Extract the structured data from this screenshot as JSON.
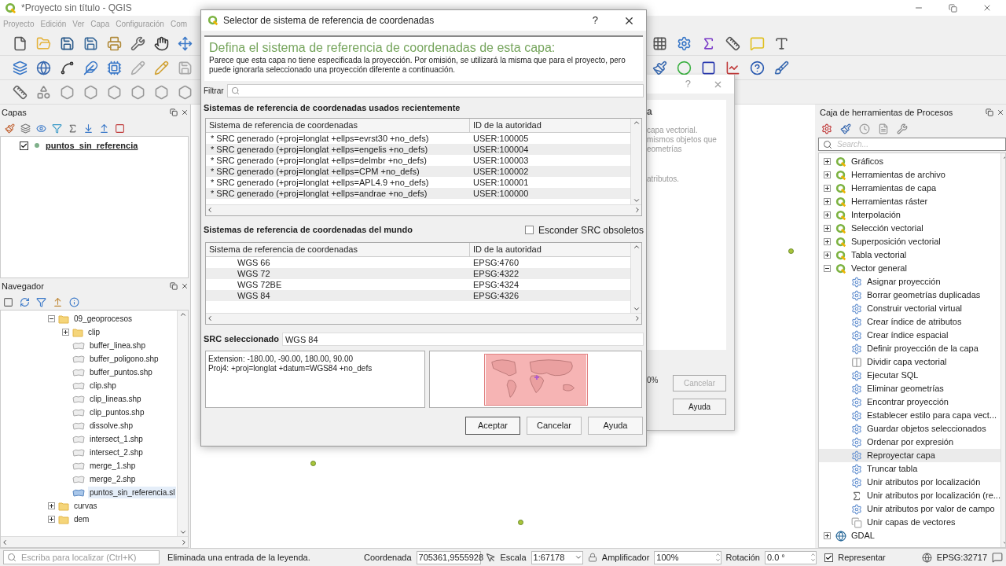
{
  "window": {
    "title": "*Proyecto sin título - QGIS"
  },
  "menu": [
    "Proyecto",
    "Edición",
    "Ver",
    "Capa",
    "Configuración",
    "Com"
  ],
  "layers_panel": {
    "title": "Capas",
    "layers": [
      {
        "name": "puntos_sin_referencia",
        "checked": true
      }
    ]
  },
  "browser_panel": {
    "title": "Navegador",
    "tree": [
      {
        "label": "09_geoprocesos",
        "kind": "folder",
        "expanded": true,
        "selected": false,
        "children": [
          {
            "label": "clip",
            "kind": "folder",
            "expanded": false,
            "selected": false
          },
          {
            "label": "buffer_linea.shp",
            "kind": "file",
            "selected": false
          },
          {
            "label": "buffer_poligono.shp",
            "kind": "file",
            "selected": false
          },
          {
            "label": "buffer_puntos.shp",
            "kind": "file",
            "selected": false
          },
          {
            "label": "clip.shp",
            "kind": "file",
            "selected": false
          },
          {
            "label": "clip_lineas.shp",
            "kind": "file",
            "selected": false
          },
          {
            "label": "clip_puntos.shp",
            "kind": "file",
            "selected": false
          },
          {
            "label": "dissolve.shp",
            "kind": "file",
            "selected": false
          },
          {
            "label": "intersect_1.shp",
            "kind": "file",
            "selected": false
          },
          {
            "label": "intersect_2.shp",
            "kind": "file",
            "selected": false
          },
          {
            "label": "merge_1.shp",
            "kind": "file",
            "selected": false
          },
          {
            "label": "merge_2.shp",
            "kind": "file",
            "selected": false
          },
          {
            "label": "puntos_sin_referencia.sl",
            "kind": "file",
            "selected": true
          }
        ]
      },
      {
        "label": "curvas",
        "kind": "folder",
        "expanded": false,
        "selected": false
      },
      {
        "label": "dem",
        "kind": "folder",
        "expanded": false,
        "selected": false
      }
    ]
  },
  "background_dialog": {
    "help_mark": "?",
    "heading_fragment": "a",
    "text_lines": [
      "capa vectorial.",
      "mismos objetos que",
      "eometrías"
    ],
    "text_tail": "atributos.",
    "progress_fragment": "0%",
    "buttons": [
      {
        "label": "Cancelar",
        "disabled": true
      },
      {
        "label": "Ayuda",
        "disabled": false
      }
    ]
  },
  "crs_dialog": {
    "title": "Selector de sistema de referencia de coordenadas",
    "help_mark": "?",
    "heading": "Defina el sistema de referencia de coordenadas de esta capa:",
    "description": "Parece que esta capa no tiene especificada la proyección. Por omisión, se utilizará la misma que para el proyecto, pero puede ignorarla seleccionado una proyección diferente a continuación.",
    "filter_label": "Filtrar",
    "recent": {
      "title": "Sistemas de referencia de coordenadas usados recientemente",
      "columns": [
        "Sistema de referencia de coordenadas",
        "ID de la autoridad"
      ],
      "rows": [
        {
          "name": "* SRC generado (+proj=longlat +ellps=evrst30 +no_defs)",
          "id": "USER:100005"
        },
        {
          "name": "* SRC generado (+proj=longlat +ellps=engelis +no_defs)",
          "id": "USER:100004"
        },
        {
          "name": "* SRC generado (+proj=longlat +ellps=delmbr +no_defs)",
          "id": "USER:100003"
        },
        {
          "name": "* SRC generado (+proj=longlat +ellps=CPM +no_defs)",
          "id": "USER:100002"
        },
        {
          "name": "* SRC generado (+proj=longlat +ellps=APL4.9 +no_defs)",
          "id": "USER:100001"
        },
        {
          "name": "* SRC generado (+proj=longlat +ellps=andrae +no_defs)",
          "id": "USER:100000"
        }
      ]
    },
    "world": {
      "title": "Sistemas de referencia de coordenadas del mundo",
      "hide_obsolete": {
        "label": "Esconder SRC obsoletos",
        "checked": false
      },
      "columns": [
        "Sistema de referencia de coordenadas",
        "ID de la autoridad"
      ],
      "rows": [
        {
          "name": "WGS 66",
          "id": "EPSG:4760"
        },
        {
          "name": "WGS 72",
          "id": "EPSG:4322"
        },
        {
          "name": "WGS 72BE",
          "id": "EPSG:4324"
        },
        {
          "name": "WGS 84",
          "id": "EPSG:4326"
        }
      ]
    },
    "selected_crs": {
      "label": "SRC seleccionado",
      "value": "WGS 84"
    },
    "details": [
      "Extension: -180.00, -90.00, 180.00, 90.00",
      "Proj4: +proj=longlat +datum=WGS84 +no_defs"
    ],
    "buttons": [
      "Aceptar",
      "Cancelar",
      "Ayuda"
    ]
  },
  "toolbox": {
    "title": "Caja de herramientas de Procesos",
    "search_placeholder": "Search...",
    "groups": [
      {
        "label": "Gráficos",
        "kind": "qgis",
        "expanded": false
      },
      {
        "label": "Herramientas de archivo",
        "kind": "qgis",
        "expanded": false
      },
      {
        "label": "Herramientas de capa",
        "kind": "qgis",
        "expanded": false
      },
      {
        "label": "Herramientas ráster",
        "kind": "qgis",
        "expanded": false
      },
      {
        "label": "Interpolación",
        "kind": "qgis",
        "expanded": false
      },
      {
        "label": "Selección vectorial",
        "kind": "qgis",
        "expanded": false
      },
      {
        "label": "Superposición vectorial",
        "kind": "qgis",
        "expanded": false
      },
      {
        "label": "Tabla vectorial",
        "kind": "qgis",
        "expanded": false
      },
      {
        "label": "Vector general",
        "kind": "qgis",
        "expanded": true,
        "children": [
          {
            "label": "Asignar proyección",
            "kind": "gear",
            "selected": false
          },
          {
            "label": "Borrar geometrías duplicadas",
            "kind": "gear",
            "selected": false
          },
          {
            "label": "Construir vectorial virtual",
            "kind": "gear",
            "selected": false
          },
          {
            "label": "Crear índice de atributos",
            "kind": "gear",
            "selected": false
          },
          {
            "label": "Crear índice espacial",
            "kind": "gear",
            "selected": false
          },
          {
            "label": "Definir proyección de la capa",
            "kind": "gear",
            "selected": false
          },
          {
            "label": "Dividir capa vectorial",
            "kind": "split",
            "selected": false
          },
          {
            "label": "Ejecutar SQL",
            "kind": "gear",
            "selected": false
          },
          {
            "label": "Eliminar geometrías",
            "kind": "gear",
            "selected": false
          },
          {
            "label": "Encontrar proyección",
            "kind": "gear",
            "selected": false
          },
          {
            "label": "Establecer estilo para capa vect...",
            "kind": "gear",
            "selected": false
          },
          {
            "label": "Guardar objetos seleccionados",
            "kind": "gear",
            "selected": false
          },
          {
            "label": "Ordenar por expresión",
            "kind": "gear",
            "selected": false
          },
          {
            "label": "Reproyectar capa",
            "kind": "gear",
            "selected": true
          },
          {
            "label": "Truncar tabla",
            "kind": "gear",
            "selected": false
          },
          {
            "label": "Unir atributos por localización",
            "kind": "gear",
            "selected": false
          },
          {
            "label": "Unir atributos por localización (re...",
            "kind": "sigma",
            "selected": false
          },
          {
            "label": "Unir atributos por valor de campo",
            "kind": "gear",
            "selected": false
          },
          {
            "label": "Unir capas de vectores",
            "kind": "merge",
            "selected": false
          }
        ]
      },
      {
        "label": "GDAL",
        "kind": "gdal",
        "expanded": false
      }
    ]
  },
  "locator": {
    "placeholder": "Escriba para localizar (Ctrl+K)"
  },
  "status_bar": {
    "message": "Eliminada una entrada de la leyenda.",
    "coordinate_label": "Coordenada",
    "coordinate": "705361,9555928",
    "scale_label": "Escala",
    "scale": "1:67178",
    "magnifier_label": "Amplificador",
    "magnifier": "100%",
    "rotation_label": "Rotación",
    "rotation": "0.0 °",
    "render_label": "Representar",
    "render": true,
    "crs": "EPSG:32717"
  }
}
